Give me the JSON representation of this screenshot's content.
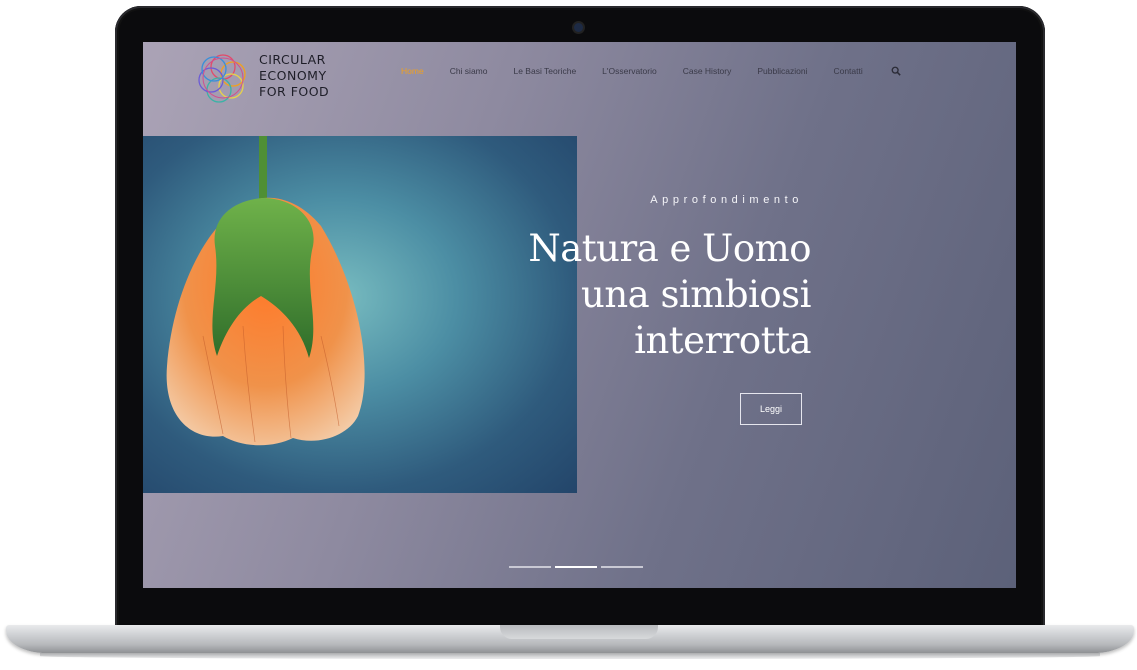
{
  "logo": {
    "lines": [
      "CIRCULAR",
      "ECONOMY",
      "FOR FOOD"
    ],
    "icon": "circular-rosette-logo",
    "colors": [
      "#e24a6a",
      "#f0a020",
      "#3bb3a6",
      "#6b5bd6",
      "#e8d24a"
    ]
  },
  "nav": {
    "items": [
      {
        "label": "Home"
      },
      {
        "label": "Chi siamo"
      },
      {
        "label": "Le Basi Teoriche"
      },
      {
        "label": "L'Osservatorio"
      },
      {
        "label": "Case History"
      },
      {
        "label": "Pubblicazioni"
      },
      {
        "label": "Contatti"
      }
    ],
    "active_index": 0,
    "search_icon": "search-icon",
    "active_color": "#f0a020"
  },
  "hero": {
    "kicker": "Approfondimento",
    "headline_lines": [
      "Natura e Uomo",
      "una simbiosi",
      "interrotta"
    ],
    "button_label": "Leggi",
    "image": "flower-bud-photo"
  },
  "slider": {
    "count": 3,
    "active_index": 1
  }
}
